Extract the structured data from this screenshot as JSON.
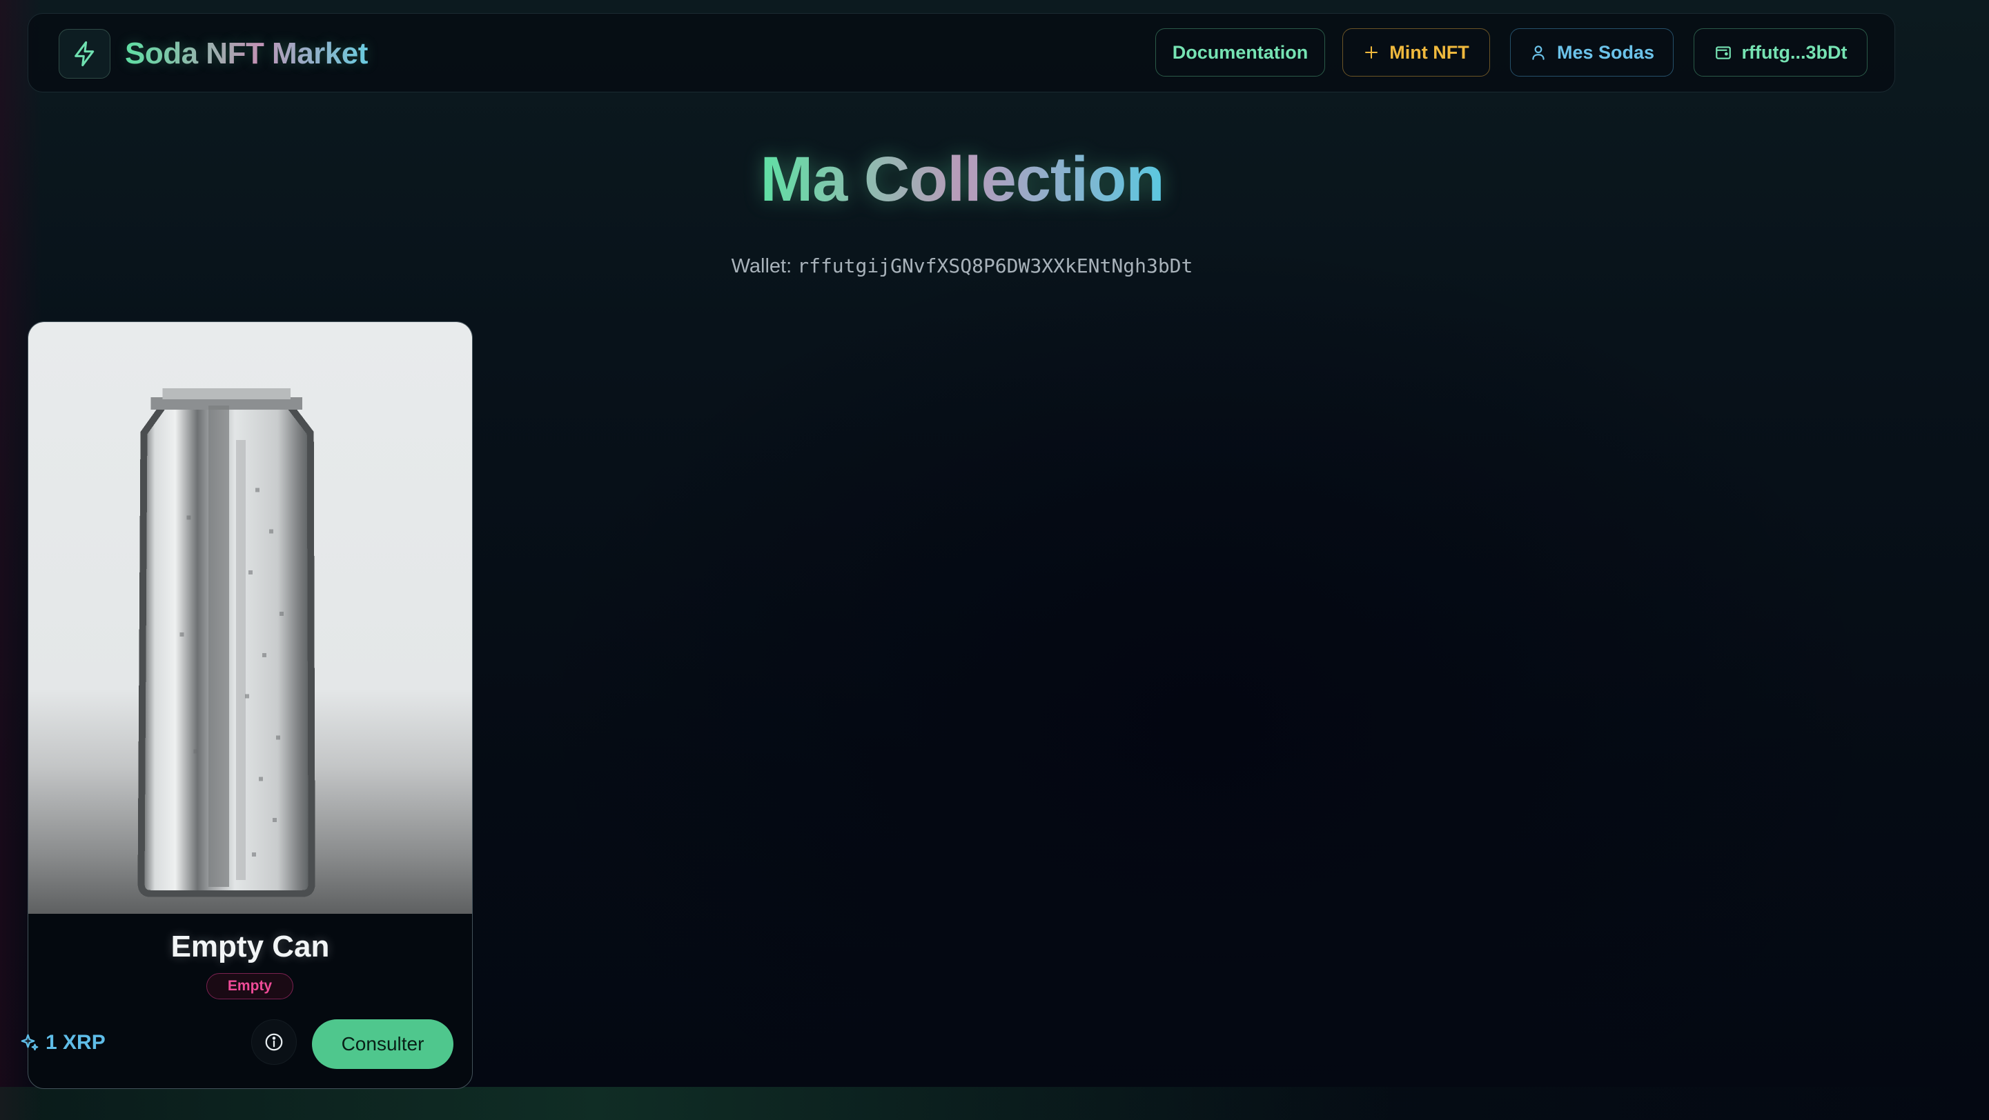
{
  "header": {
    "brand": "Soda NFT Market",
    "nav": {
      "documentation": "Documentation",
      "mint": "Mint NFT",
      "mes_sodas": "Mes Sodas",
      "wallet_short": "rffutg...3bDt"
    }
  },
  "page": {
    "title": "Ma Collection",
    "wallet_label": "Wallet:",
    "wallet_address": "rffutgijGNvfXSQ8P6DW3XXkENtNgh3bDt"
  },
  "collection": [
    {
      "name": "Empty Can",
      "badge": "Empty",
      "price": "1 XRP",
      "action": "Consulter"
    }
  ],
  "icons": {
    "logo": "lightning-icon",
    "mint": "plus-icon",
    "mes_sodas": "user-icon",
    "wallet": "wallet-icon",
    "price": "sparkles-icon",
    "info": "info-icon"
  },
  "colors": {
    "accent_green": "#4fc78d",
    "accent_amber": "#f0b93d",
    "accent_blue": "#6cc3ea",
    "badge_pink": "#ee4b97"
  }
}
